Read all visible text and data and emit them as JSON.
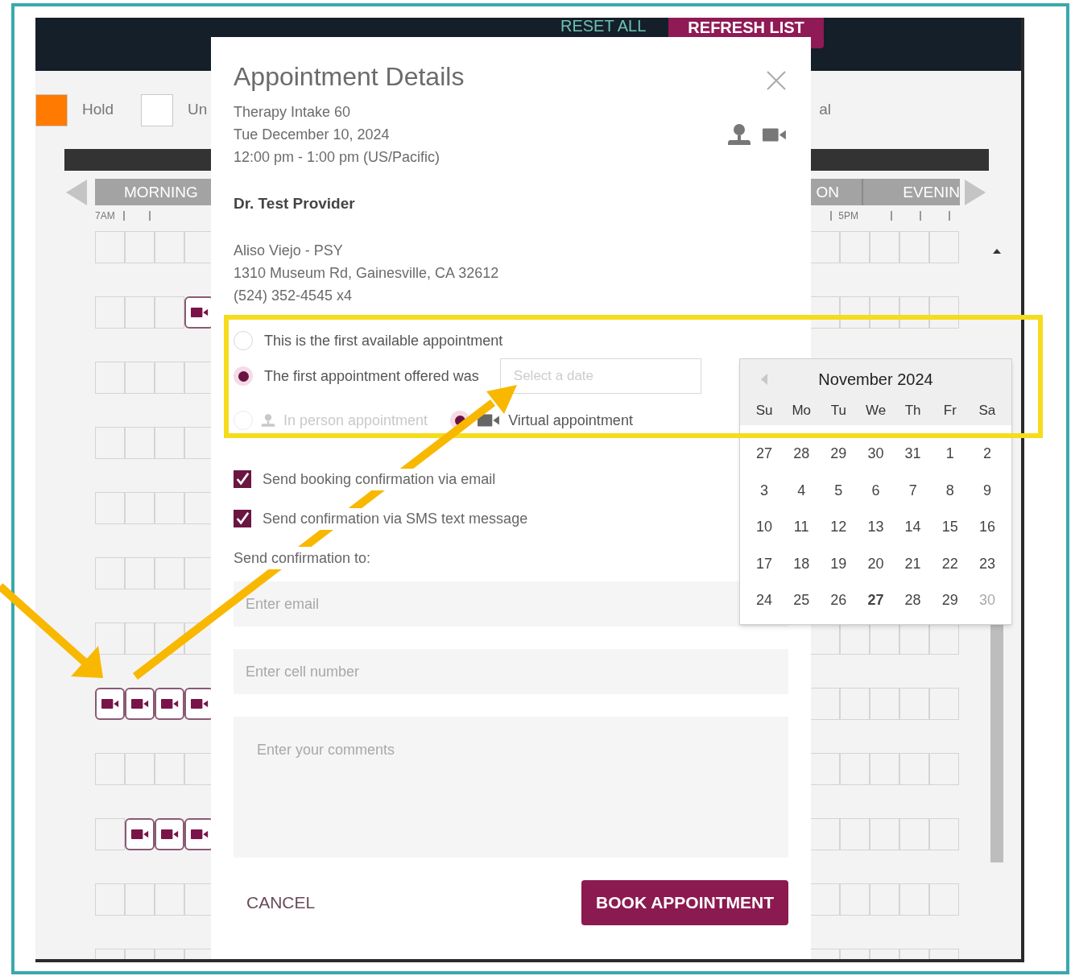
{
  "header": {
    "buttons": [
      {
        "label": "RESET ALL",
        "kind": "text"
      },
      {
        "label": "REFRESH LIST",
        "kind": "primary"
      }
    ]
  },
  "legend": [
    {
      "label": "Hold",
      "color": "#ff7a00"
    },
    {
      "label": "Un",
      "color": "#ffffff"
    }
  ],
  "legend_right": "al",
  "day_parts": [
    "MORNING",
    "ON",
    "EVENIN"
  ],
  "time_ticks": [
    "7AM",
    "5PM"
  ],
  "schedule_rows": [
    {
      "slots": [
        {
          "video": false
        },
        {
          "video": false
        },
        {
          "video": false
        },
        {
          "video": false
        },
        {
          "video": false
        },
        {
          "video": false
        },
        {
          "video": false
        },
        {
          "video": false
        },
        {
          "video": false
        }
      ]
    },
    {
      "slots": [
        {
          "video": false
        },
        {
          "video": false
        },
        {
          "video": false
        },
        {
          "video": true
        },
        {
          "video": false
        },
        {
          "video": false
        },
        {
          "video": false
        },
        {
          "video": false
        },
        {
          "video": false
        }
      ]
    },
    {
      "slots": [
        {
          "video": false
        },
        {
          "video": false
        },
        {
          "video": false
        },
        {
          "video": false
        }
      ]
    },
    {
      "slots": [
        {
          "video": false
        },
        {
          "video": false
        },
        {
          "video": false
        },
        {
          "video": false
        }
      ]
    },
    {
      "slots": [
        {
          "video": false
        },
        {
          "video": false
        },
        {
          "video": false
        },
        {
          "video": false
        }
      ]
    },
    {
      "slots": [
        {
          "video": false
        },
        {
          "video": false
        },
        {
          "video": false
        },
        {
          "video": false
        }
      ]
    },
    {
      "slots": [
        {
          "video": false
        },
        {
          "video": false
        },
        {
          "video": false
        },
        {
          "video": false
        },
        {
          "video": false
        },
        {
          "video": false
        },
        {
          "video": false
        },
        {
          "video": false
        },
        {
          "video": false
        }
      ]
    },
    {
      "slots": [
        {
          "video": true
        },
        {
          "video": true
        },
        {
          "video": true
        },
        {
          "video": true
        },
        {
          "video": false
        },
        {
          "video": false
        },
        {
          "video": false
        },
        {
          "video": false
        },
        {
          "video": false
        }
      ]
    },
    {
      "slots": [
        {
          "video": false
        },
        {
          "video": false
        },
        {
          "video": false
        },
        {
          "video": false
        },
        {
          "video": false
        },
        {
          "video": false
        },
        {
          "video": false
        },
        {
          "video": false
        },
        {
          "video": false
        }
      ]
    },
    {
      "slots": [
        {
          "video": false
        },
        {
          "video": true
        },
        {
          "video": true
        },
        {
          "video": true
        },
        {
          "video": false
        },
        {
          "video": false
        },
        {
          "video": false
        },
        {
          "video": false
        },
        {
          "video": false
        }
      ]
    },
    {
      "slots": [
        {
          "video": false
        },
        {
          "video": false
        },
        {
          "video": false
        },
        {
          "video": false
        },
        {
          "video": false
        },
        {
          "video": false
        },
        {
          "video": false
        },
        {
          "video": false
        },
        {
          "video": false
        }
      ]
    },
    {
      "slots": [
        {
          "video": false
        },
        {
          "video": false
        },
        {
          "video": false
        },
        {
          "video": false
        },
        {
          "video": false
        },
        {
          "video": false
        },
        {
          "video": false
        },
        {
          "video": false
        },
        {
          "video": false
        }
      ]
    }
  ],
  "modal": {
    "title": "Appointment Details",
    "appointment_type": "Therapy Intake 60",
    "date": "Tue December 10, 2024",
    "time": "12:00 pm - 1:00 pm (US/Pacific)",
    "provider": "Dr. Test Provider",
    "location": "Aliso Viejo - PSY",
    "address": "1310 Museum Rd, Gainesville, CA 32612",
    "phone": "(524) 352-4545 x4",
    "availability_options": [
      {
        "label": "This is the first available appointment",
        "selected": false
      },
      {
        "label": "The first appointment offered was",
        "selected": true
      }
    ],
    "date_field": {
      "placeholder": "Select a date"
    },
    "mode_options": [
      {
        "label": "In person appointment",
        "kind": "in_person",
        "selected": false,
        "disabled": true
      },
      {
        "label": "Virtual appointment",
        "kind": "virtual",
        "selected": true,
        "disabled": false
      }
    ],
    "notifications": [
      {
        "label": "Send booking confirmation via email",
        "checked": true
      },
      {
        "label": "Send confirmation via SMS text message",
        "checked": true
      }
    ],
    "send_to_label": "Send confirmation to:",
    "email_field": {
      "placeholder": "Enter email"
    },
    "cell_field": {
      "placeholder": "Enter cell number"
    },
    "comments_field": {
      "placeholder": "Enter your comments"
    },
    "cancel_label": "CANCEL",
    "book_label": "BOOK APPOINTMENT"
  },
  "calendar": {
    "title": "November 2024",
    "weekdays": [
      "Su",
      "Mo",
      "Tu",
      "We",
      "Th",
      "Fr",
      "Sa"
    ],
    "days": [
      {
        "label": "27",
        "disabled": false,
        "today": false
      },
      {
        "label": "28",
        "disabled": false,
        "today": false
      },
      {
        "label": "29",
        "disabled": false,
        "today": false
      },
      {
        "label": "30",
        "disabled": false,
        "today": false
      },
      {
        "label": "31",
        "disabled": false,
        "today": false
      },
      {
        "label": "1",
        "disabled": false,
        "today": false
      },
      {
        "label": "2",
        "disabled": false,
        "today": false
      },
      {
        "label": "3",
        "disabled": false,
        "today": false
      },
      {
        "label": "4",
        "disabled": false,
        "today": false
      },
      {
        "label": "5",
        "disabled": false,
        "today": false
      },
      {
        "label": "6",
        "disabled": false,
        "today": false
      },
      {
        "label": "7",
        "disabled": false,
        "today": false
      },
      {
        "label": "8",
        "disabled": false,
        "today": false
      },
      {
        "label": "9",
        "disabled": false,
        "today": false
      },
      {
        "label": "10",
        "disabled": false,
        "today": false
      },
      {
        "label": "11",
        "disabled": false,
        "today": false
      },
      {
        "label": "12",
        "disabled": false,
        "today": false
      },
      {
        "label": "13",
        "disabled": false,
        "today": false
      },
      {
        "label": "14",
        "disabled": false,
        "today": false
      },
      {
        "label": "15",
        "disabled": false,
        "today": false
      },
      {
        "label": "16",
        "disabled": false,
        "today": false
      },
      {
        "label": "17",
        "disabled": false,
        "today": false
      },
      {
        "label": "18",
        "disabled": false,
        "today": false
      },
      {
        "label": "19",
        "disabled": false,
        "today": false
      },
      {
        "label": "20",
        "disabled": false,
        "today": false
      },
      {
        "label": "21",
        "disabled": false,
        "today": false
      },
      {
        "label": "22",
        "disabled": false,
        "today": false
      },
      {
        "label": "23",
        "disabled": false,
        "today": false
      },
      {
        "label": "24",
        "disabled": false,
        "today": false
      },
      {
        "label": "25",
        "disabled": false,
        "today": false
      },
      {
        "label": "26",
        "disabled": false,
        "today": false
      },
      {
        "label": "27",
        "disabled": false,
        "today": true
      },
      {
        "label": "28",
        "disabled": false,
        "today": false
      },
      {
        "label": "29",
        "disabled": false,
        "today": false
      },
      {
        "label": "30",
        "disabled": true,
        "today": false
      }
    ]
  }
}
